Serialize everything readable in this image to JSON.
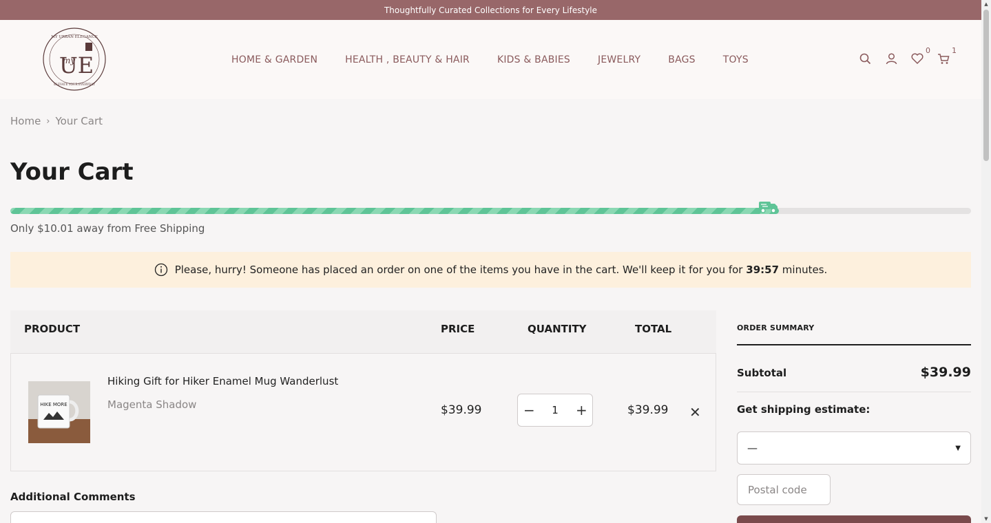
{
  "announcement": "Thoughtfully Curated Collections for Every Lifestyle",
  "logo": {
    "text_top": "MY URBAN ELEGANCE",
    "mark": "UE",
    "script": "my",
    "text_bottom": "ELEVATE YOUR EVERYDAY"
  },
  "nav": [
    "HOME & GARDEN",
    "HEALTH , BEAUTY & HAIR",
    "KIDS & BABIES",
    "JEWELRY",
    "BAGS",
    "TOYS"
  ],
  "header_icons": {
    "search": "search-icon",
    "account": "user-icon",
    "wishlist": "heart-icon",
    "cart": "cart-icon"
  },
  "wishlist_count": "0",
  "cart_count": "1",
  "breadcrumb": {
    "home": "Home",
    "current": "Your Cart"
  },
  "page_title": "Your Cart",
  "shipping": {
    "message": "Only $10.01 away from Free Shipping",
    "progress": 0.8
  },
  "hurry": {
    "text_before": "Please, hurry! Someone has placed an order on one of the items you have in the cart. We'll keep it for you for",
    "timer": "39:57",
    "text_after": "minutes."
  },
  "table": {
    "headers": {
      "product": "PRODUCT",
      "price": "PRICE",
      "quantity": "QUANTITY",
      "total": "TOTAL"
    }
  },
  "cart_item": {
    "name": "Hiking Gift for Hiker Enamel Mug Wanderlust",
    "variant": "Magenta Shadow",
    "price": "$39.99",
    "quantity": "1",
    "total": "$39.99",
    "mug_text": "HIKE MORE"
  },
  "comments": {
    "label": "Additional Comments"
  },
  "summary": {
    "title": "ORDER SUMMARY",
    "subtotal_label": "Subtotal",
    "subtotal_value": "$39.99",
    "shipping_label": "Get shipping estimate:",
    "country_value": "—",
    "postal_placeholder": "Postal code"
  },
  "colors": {
    "brand": "#986769",
    "progress": "#5fc497",
    "notice_bg": "#fdf0dd"
  }
}
